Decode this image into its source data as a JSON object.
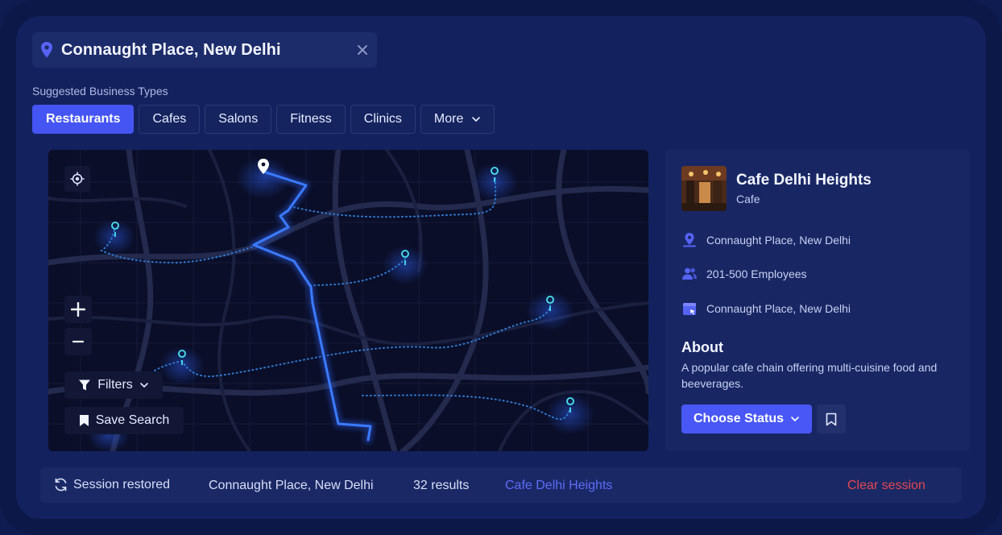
{
  "search": {
    "location": "Connaught Place, New Delhi",
    "icon": "location-pin-icon",
    "clear_icon": "close-icon"
  },
  "suggestions": {
    "label": "Suggested Business Types",
    "chips": [
      "Restaurants",
      "Cafes",
      "Salons",
      "Fitness",
      "Clinics"
    ],
    "active": "Restaurants",
    "more_label": "More"
  },
  "map": {
    "filters_label": "Filters",
    "save_search_label": "Save Search",
    "zoom_in": "+",
    "zoom_out": "−"
  },
  "business": {
    "name": "Cafe Delhi Heights",
    "category": "Cafe",
    "address": "Connaught Place, New Delhi",
    "employees": "201-500 Employees",
    "location": "Connaught Place, New Delhi",
    "about_title": "About",
    "about_text": "A popular cafe chain offering multi-cuisine food and beeverages.",
    "status_button": "Choose Status"
  },
  "statusbar": {
    "restored": "Session restored",
    "location": "Connaught Place, New Delhi",
    "results": "32 results",
    "selected": "Cafe Delhi Heights",
    "clear": "Clear session"
  },
  "colors": {
    "accent": "#4555f3",
    "link": "#5d6cf7",
    "danger": "#e5474f",
    "route": "#3a7bff",
    "marker": "#3ed1e6"
  }
}
